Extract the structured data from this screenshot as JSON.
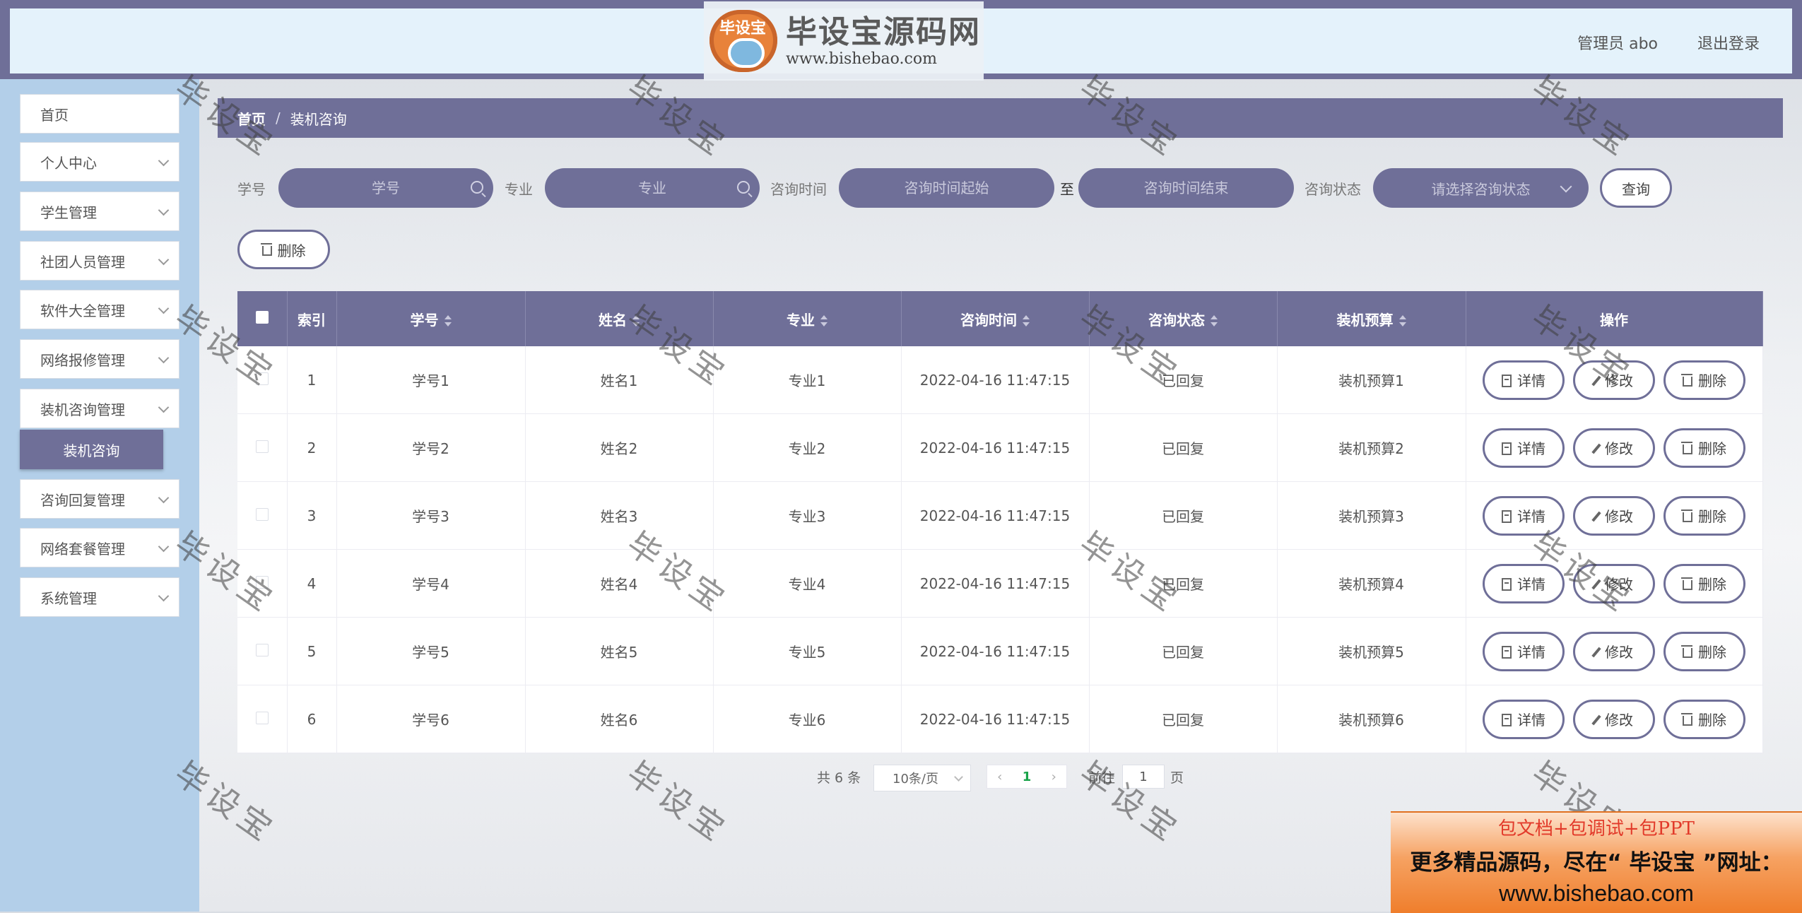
{
  "header": {
    "logo_badge": "毕设宝",
    "logo_title": "毕设宝源码网",
    "logo_url": "www.bishebao.com",
    "user": "管理员 abo",
    "logout": "退出登录"
  },
  "sidebar": {
    "items": [
      {
        "label": "首页",
        "has_arrow": false
      },
      {
        "label": "个人中心",
        "has_arrow": true
      },
      {
        "label": "学生管理",
        "has_arrow": true
      },
      {
        "label": "社团人员管理",
        "has_arrow": true
      },
      {
        "label": "软件大全管理",
        "has_arrow": true
      },
      {
        "label": "网络报修管理",
        "has_arrow": true
      },
      {
        "label": "装机咨询管理",
        "has_arrow": true
      },
      {
        "label": "咨询回复管理",
        "has_arrow": true
      },
      {
        "label": "网络套餐管理",
        "has_arrow": true
      },
      {
        "label": "系统管理",
        "has_arrow": true
      }
    ],
    "active_sub": "装机咨询"
  },
  "breadcrumb": {
    "home": "首页",
    "separator": "/",
    "current": "装机咨询"
  },
  "search": {
    "student_no_label": "学号",
    "student_no_placeholder": "学号",
    "major_label": "专业",
    "major_placeholder": "专业",
    "time_label": "咨询时间",
    "time_start_placeholder": "咨询时间起始",
    "to_text": "至",
    "time_end_placeholder": "咨询时间结束",
    "status_label": "咨询状态",
    "status_placeholder": "请选择咨询状态",
    "query_button": "查询"
  },
  "toolbar": {
    "delete_button": "删除"
  },
  "table": {
    "columns": [
      "索引",
      "学号",
      "姓名",
      "专业",
      "咨询时间",
      "咨询状态",
      "装机预算",
      "操作"
    ],
    "rows": [
      {
        "index": "1",
        "student_no": "学号1",
        "name": "姓名1",
        "major": "专业1",
        "time": "2022-04-16 11:47:15",
        "status": "已回复",
        "budget": "装机预算1"
      },
      {
        "index": "2",
        "student_no": "学号2",
        "name": "姓名2",
        "major": "专业2",
        "time": "2022-04-16 11:47:15",
        "status": "已回复",
        "budget": "装机预算2"
      },
      {
        "index": "3",
        "student_no": "学号3",
        "name": "姓名3",
        "major": "专业3",
        "time": "2022-04-16 11:47:15",
        "status": "已回复",
        "budget": "装机预算3"
      },
      {
        "index": "4",
        "student_no": "学号4",
        "name": "姓名4",
        "major": "专业4",
        "time": "2022-04-16 11:47:15",
        "status": "已回复",
        "budget": "装机预算4"
      },
      {
        "index": "5",
        "student_no": "学号5",
        "name": "姓名5",
        "major": "专业5",
        "time": "2022-04-16 11:47:15",
        "status": "已回复",
        "budget": "装机预算5"
      },
      {
        "index": "6",
        "student_no": "学号6",
        "name": "姓名6",
        "major": "专业6",
        "time": "2022-04-16 11:47:15",
        "status": "已回复",
        "budget": "装机预算6"
      }
    ],
    "actions": {
      "detail": "详情",
      "edit": "修改",
      "delete": "删除"
    }
  },
  "pagination": {
    "total_text": "共 6 条",
    "page_size": "10条/页",
    "current_page": "1",
    "goto_label": "前往",
    "goto_value": "1",
    "page_suffix": "页"
  },
  "watermark": "毕设宝",
  "ad": {
    "line1": "包文档+包调试+包PPT",
    "line2": "更多精品源码，尽在“ 毕设宝 ”网址：",
    "line3": "www.bishebao.com"
  },
  "colors": {
    "theme": "#6f6f98",
    "sidebar_bg": "#b3cfe9",
    "header_bg": "#e4f2fb",
    "active_page": "#1aa34a"
  }
}
